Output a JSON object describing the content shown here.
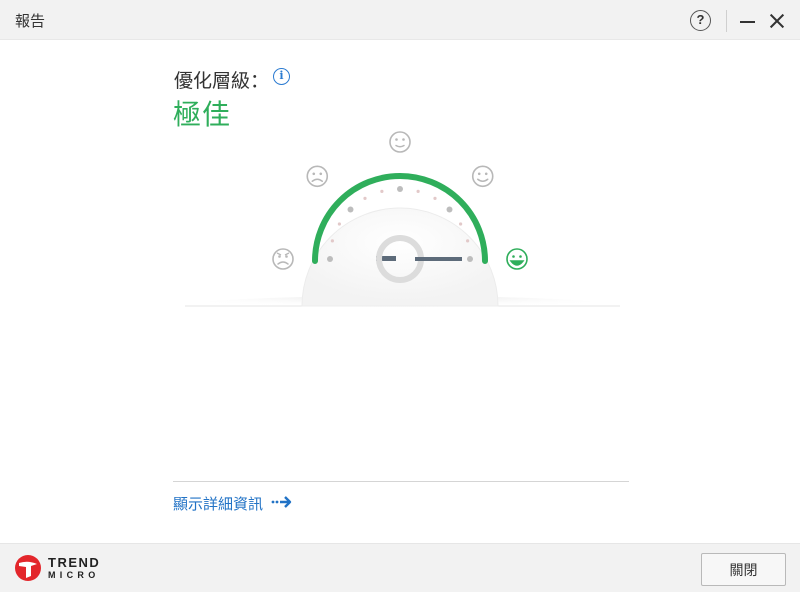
{
  "window": {
    "title": "報告",
    "help_label": "?"
  },
  "optimization": {
    "label": "優化層級：",
    "value": "極佳",
    "info_icon": "info-icon",
    "level_index": 5,
    "level_count": 5,
    "accent_color": "#2fae5b"
  },
  "gauge": {
    "faces": [
      "angry-face-icon",
      "sad-face-icon",
      "neutral-face-icon",
      "content-face-icon",
      "happy-face-icon"
    ]
  },
  "details": {
    "link_label": "顯示詳細資訊",
    "arrow_icon": "arrow-right-icon"
  },
  "footer": {
    "logo_line1": "TREND",
    "logo_line2": "MICRO",
    "close_label": "關閉"
  }
}
